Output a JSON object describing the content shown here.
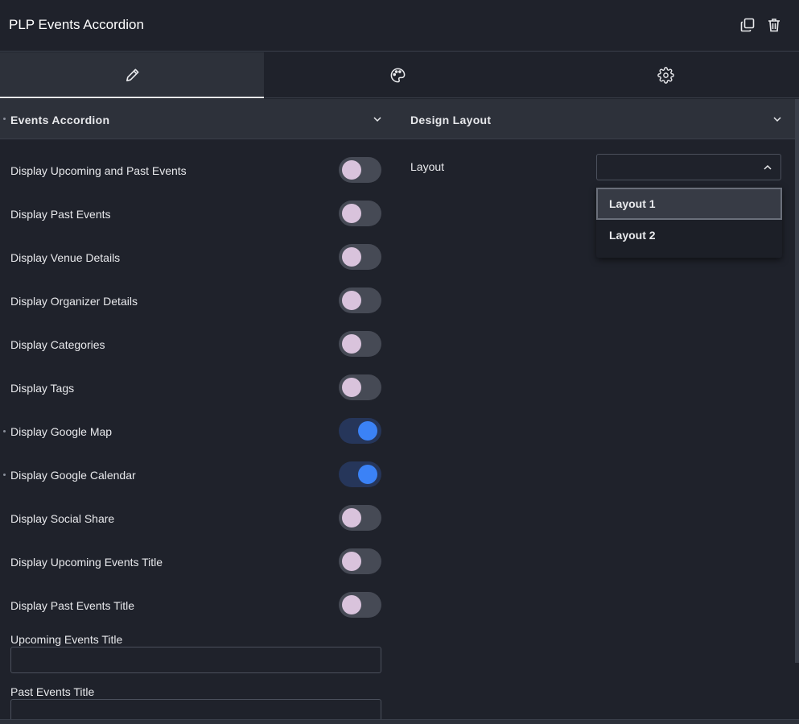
{
  "header": {
    "title": "PLP Events Accordion"
  },
  "events_section": {
    "title": "Events Accordion",
    "toggles": [
      {
        "label": "Display Upcoming and Past Events",
        "on": false
      },
      {
        "label": "Display Past Events",
        "on": false
      },
      {
        "label": "Display Venue Details",
        "on": false
      },
      {
        "label": "Display Organizer Details",
        "on": false
      },
      {
        "label": "Display Categories",
        "on": false
      },
      {
        "label": "Display Tags",
        "on": false
      },
      {
        "label": "Display Google Map",
        "on": true
      },
      {
        "label": "Display Google Calendar",
        "on": true
      },
      {
        "label": "Display Social Share",
        "on": false
      },
      {
        "label": "Display Upcoming Events Title",
        "on": false
      },
      {
        "label": "Display Past Events Title",
        "on": false
      }
    ],
    "fields": [
      {
        "label": "Upcoming Events Title",
        "value": ""
      },
      {
        "label": "Past Events Title",
        "value": ""
      }
    ]
  },
  "design_section": {
    "title": "Design Layout",
    "layout_label": "Layout",
    "layout_value": "",
    "options": [
      "Layout 1",
      "Layout 2"
    ]
  },
  "colors": {
    "toggle_on": "#3b82f6",
    "toggle_off_knob": "#d9c3dc",
    "panel": "#1f222b"
  }
}
